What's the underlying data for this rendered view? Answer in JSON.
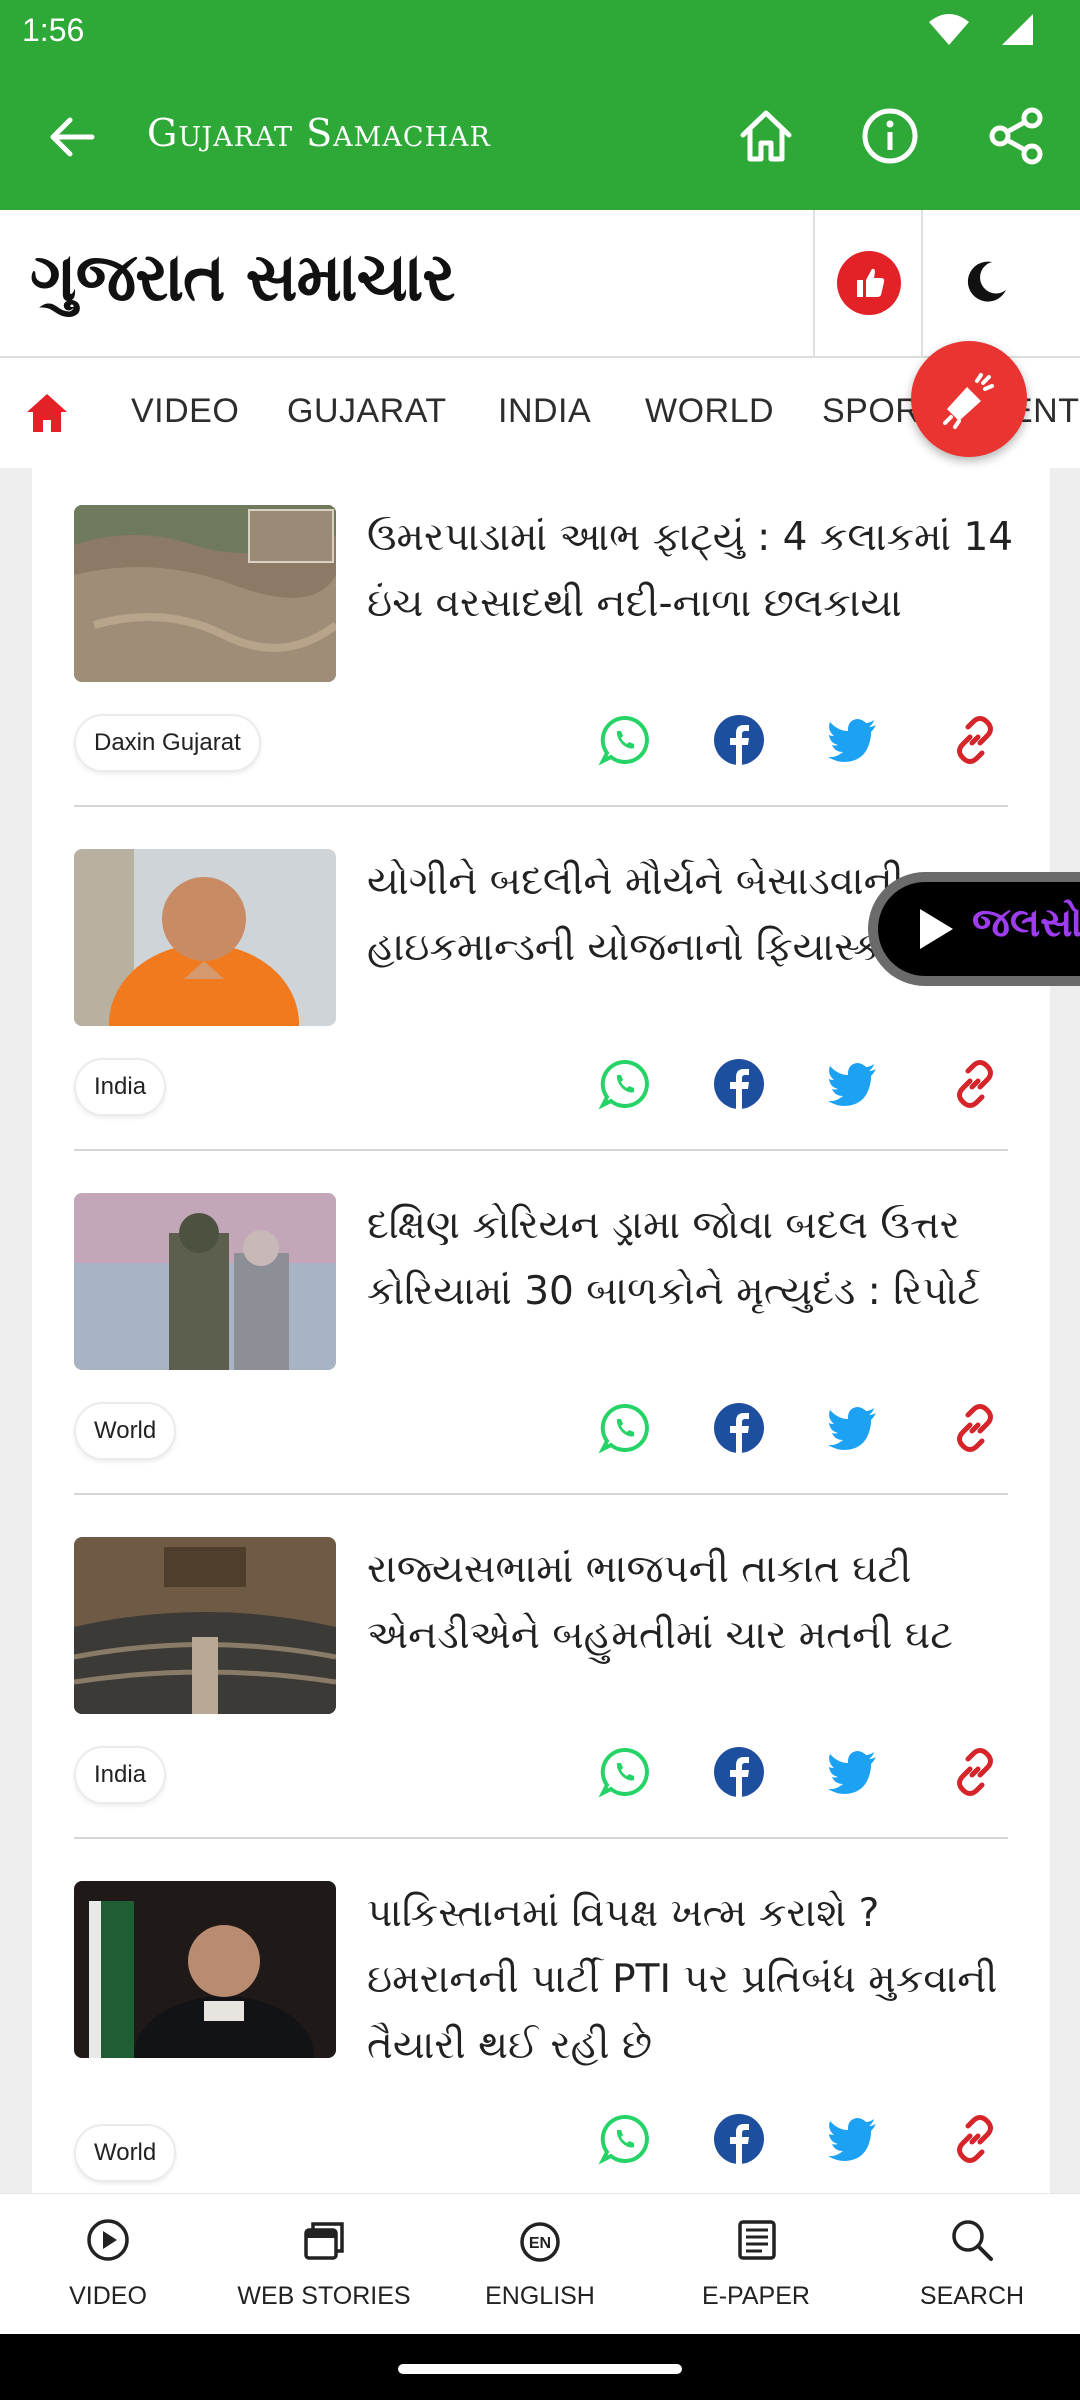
{
  "status_bar": {
    "time": "1:56"
  },
  "app_bar": {
    "title": "Gujarat Samachar"
  },
  "logo": {
    "text": "ગુજરાત સમાચાર"
  },
  "tabs": [
    "VIDEO",
    "GUJARAT",
    "INDIA",
    "WORLD",
    "SPORTS",
    "ENT"
  ],
  "video_pill": {
    "label": "જલસો"
  },
  "articles": [
    {
      "headline": "ઉમરપાડામાં આભ ફાટ્યું : 4 કલાકમાં 14 ઇંચ વરસાદથી નદી-નાળા છલકાયા",
      "tag": "Daxin Gujarat"
    },
    {
      "headline": "યોગીને બદલીને મૌર્યને બેસાડવાની હાઇકમાન્ડની યોજનાનો ફિયાસ્કો",
      "tag": "India"
    },
    {
      "headline": "દક્ષિણ કોરિયન ડ્રામા જોવા બદલ ઉત્તર કોરિયામાં 30 બાળકોને મૃત્યુદંડ : રિપોર્ટ",
      "tag": "World"
    },
    {
      "headline": "રાજ્યસભામાં ભાજપની તાકાત ઘટી એનડીએને બહુમતીમાં ચાર મતની ઘટ",
      "tag": "India"
    },
    {
      "headline": "પાકિસ્તાનમાં વિપક્ષ ખત્મ કરાશે ? ઇમરાનની પાર્ટી PTI પર પ્રતિબંધ મુકવાની તૈયારી થઈ રહી છે",
      "tag": "World"
    }
  ],
  "bottom_nav": [
    {
      "label": "VIDEO",
      "icon": "play-circle-icon"
    },
    {
      "label": "WEB STORIES",
      "icon": "stories-icon"
    },
    {
      "label": "ENGLISH",
      "icon": "en-icon"
    },
    {
      "label": "E-PAPER",
      "icon": "newspaper-icon"
    },
    {
      "label": "SEARCH",
      "icon": "search-icon"
    }
  ],
  "colors": {
    "brand_green": "#2ea836",
    "accent_red": "#e32228",
    "whatsapp": "#25d366",
    "facebook": "#1d4f9e",
    "twitter": "#1da1f2",
    "link": "#d6242a"
  }
}
